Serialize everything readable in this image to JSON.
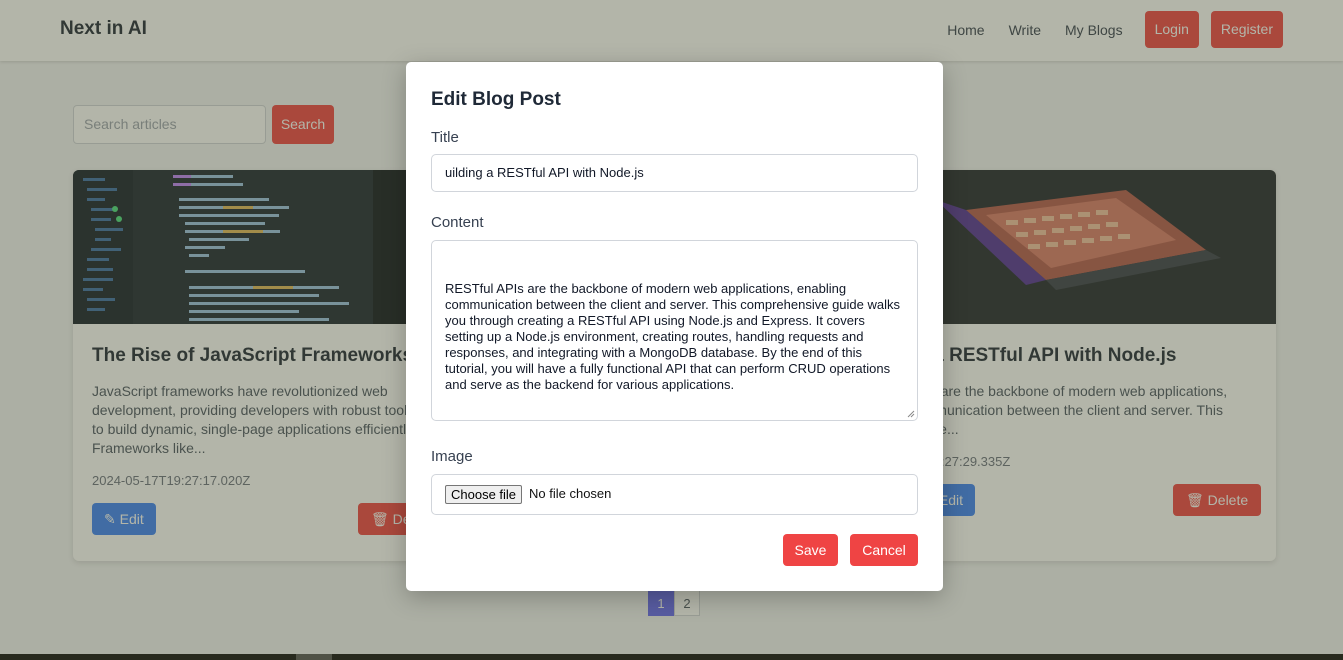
{
  "nav": {
    "brand": "Next in AI",
    "links": [
      "Home",
      "Write",
      "My Blogs"
    ],
    "login": "Login",
    "register": "Register"
  },
  "search": {
    "placeholder": "Search articles",
    "button": "Search"
  },
  "cards": [
    {
      "title": "The Rise of JavaScript Frameworks",
      "excerpt": "JavaScript frameworks have revolutionized web development, providing developers with robust tools to build dynamic, single-page applications efficiently. Frameworks like...",
      "date": "2024-05-17T19:27:17.020Z",
      "edit": "Edit",
      "delete": "Delete"
    },
    {
      "title": "Building a RESTful API with Node.js",
      "excerpt": "RESTful APIs are the backbone of modern web applications, enabling communication between the client and server. This comprehensive...",
      "date": "2024-05-17T19:27:29.335Z",
      "edit": "Edit",
      "delete": "Delete"
    }
  ],
  "pagination": {
    "pages": [
      "1",
      "2"
    ],
    "active": "1"
  },
  "modal": {
    "heading": "Edit Blog Post",
    "title_label": "Title",
    "title_value": "uilding a RESTful API with Node.js",
    "content_label": "Content",
    "content_value": " RESTful APIs are the backbone of modern web applications, enabling communication between the client and server. This comprehensive guide walks you through creating a RESTful API using Node.js and Express. It covers setting up a Node.js environment, creating routes, handling requests and responses, and integrating with a MongoDB database. By the end of this tutorial, you will have a fully functional API that can perform CRUD operations and serve as the backend for various applications.",
    "image_label": "Image",
    "file_button": "Choose file",
    "file_status": "No file chosen",
    "save": "Save",
    "cancel": "Cancel"
  },
  "colors": {
    "accent": "#ef4444",
    "edit": "#3b82f6",
    "page_active": "#6366f1"
  }
}
